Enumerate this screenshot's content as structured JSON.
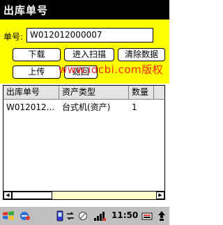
{
  "titlebar": {
    "title": "出库单号"
  },
  "form": {
    "order_label": "单号:",
    "order_value": "W012012000007"
  },
  "buttons": {
    "download": "下载",
    "scan": "进入扫描",
    "clear": "清除数据",
    "upload": "上传",
    "back": "返回"
  },
  "watermark": "www.idcbi.com版权",
  "grid": {
    "headers": [
      "出库单号",
      "资产类型",
      "数量"
    ],
    "rows": [
      [
        "W012012...",
        "台式机(资产)",
        "1"
      ]
    ]
  },
  "taskbar": {
    "time": "11:50"
  }
}
